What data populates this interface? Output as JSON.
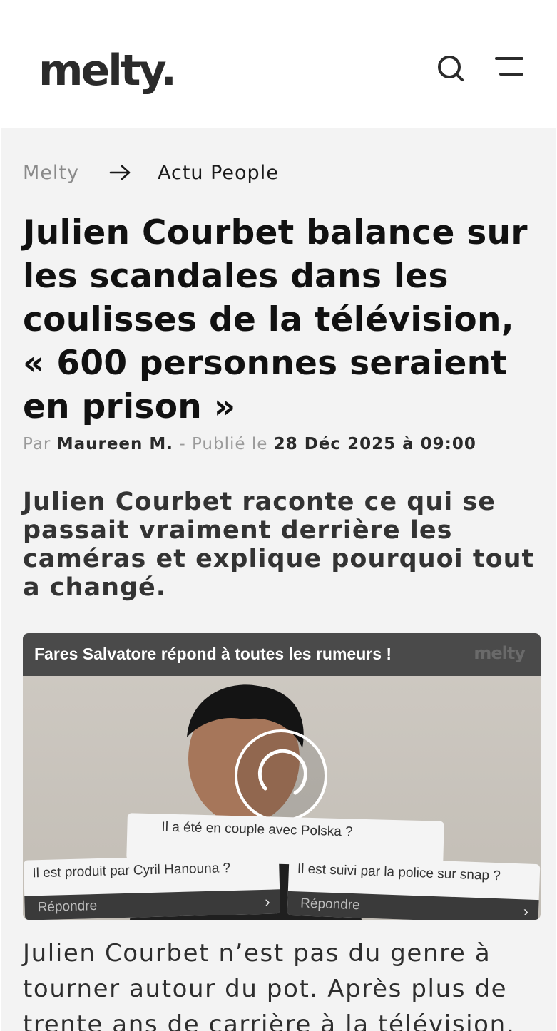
{
  "header": {
    "logo_text": "melty.",
    "search_icon": "search-icon",
    "menu_icon": "menu-icon"
  },
  "breadcrumb": {
    "home": "Melty",
    "arrow_icon": "arrow-right-icon",
    "current": "Actu People"
  },
  "article": {
    "title": "Julien Courbet balance sur les scandales dans les coulisses de la télévision, « 600 personnes seraient en prison »",
    "byline_prefix": "Par",
    "author": "Maureen M.",
    "published_label": "- Publié le",
    "published_date": "28 Déc 2025 à 09:00",
    "lead": "Julien Courbet raconte ce qui se passait vraiment derrière les caméras et explique pourquoi tout a changé.",
    "body_excerpt": "Julien Courbet n’est pas du genre à tourner autour du pot. Après plus de trente ans de carrière à la télévision,"
  },
  "video": {
    "title": "Fares Salvatore répond à toutes les rumeurs !",
    "watermark": "melty",
    "cards": [
      {
        "question": "Il a été en couple avec Polska ?",
        "reply": "Répondre"
      },
      {
        "question": "Il est produit par Cyril Hanouna ?",
        "reply": "Répondre"
      },
      {
        "question": "Il est suivi par la police sur snap ?",
        "reply": "Répondre"
      }
    ],
    "chevron": "›",
    "loading_icon": "loading-spinner-icon"
  },
  "colors": {
    "page_bg": "#f3f3f3",
    "header_bg": "#ffffff",
    "title": "#111111",
    "muted": "#9a9a9a"
  }
}
